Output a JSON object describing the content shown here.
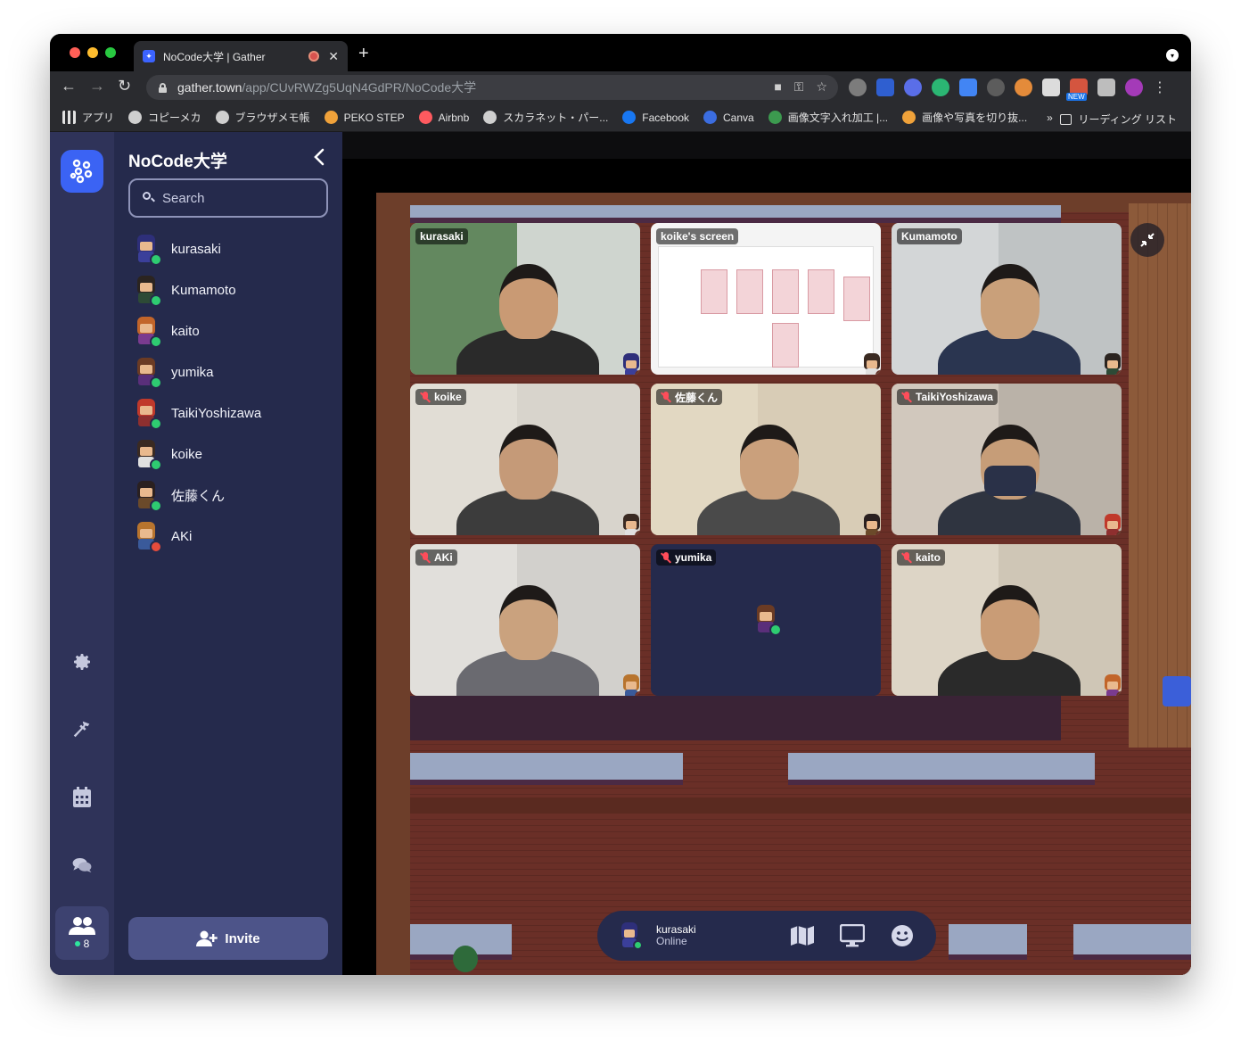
{
  "browser": {
    "tab_title": "NoCode大学 | Gather",
    "tab_close": "✕",
    "new_tab": "+",
    "url_host": "gather.town",
    "url_path": "/app/CUvRWZg5UqN4GdPR/NoCode大学",
    "nav": {
      "back": "←",
      "forward": "→",
      "reload": "↻"
    },
    "ext_new_badge": "NEW",
    "bookmarks": [
      {
        "label": "アプリ",
        "icon": "apps-grid-icon",
        "color": "#e3e3e3"
      },
      {
        "label": "コピーメカ",
        "icon": "globe-icon",
        "color": "#cfcfcf"
      },
      {
        "label": "ブラウザメモ帳",
        "icon": "globe-icon",
        "color": "#cfcfcf"
      },
      {
        "label": "PEKO STEP",
        "icon": "peko-icon",
        "color": "#f0a23a"
      },
      {
        "label": "Airbnb",
        "icon": "airbnb-icon",
        "color": "#ff5a5f"
      },
      {
        "label": "スカラネット・パー...",
        "icon": "globe-icon",
        "color": "#cfcfcf"
      },
      {
        "label": "Facebook",
        "icon": "facebook-icon",
        "color": "#1877f2"
      },
      {
        "label": "Canva",
        "icon": "canva-icon",
        "color": "#3b6de0"
      },
      {
        "label": "画像文字入れ加工 |...",
        "icon": "image-icon",
        "color": "#3c9a4f"
      },
      {
        "label": "画像や写真を切り抜...",
        "icon": "peko-icon",
        "color": "#f0a23a"
      }
    ],
    "bookmarks_more": "»",
    "reading_list": "リーディング リスト"
  },
  "sidebar": {
    "title": "NoCode大学",
    "search_placeholder": "Search",
    "invite_label": "Invite",
    "online_count": "8",
    "users": [
      {
        "name": "kurasaki",
        "hair": "#2e2f7a",
        "shirt": "#3b3f9a",
        "status": "#2ecc71"
      },
      {
        "name": "Kumamoto",
        "hair": "#2b2420",
        "shirt": "#2d4a36",
        "status": "#2ecc71"
      },
      {
        "name": "kaito",
        "hair": "#c2652a",
        "shirt": "#7a3b8f",
        "status": "#2ecc71"
      },
      {
        "name": "yumika",
        "hair": "#6b3b24",
        "shirt": "#5a2f7a",
        "status": "#2ecc71"
      },
      {
        "name": "TaikiYoshizawa",
        "hair": "#c0392b",
        "shirt": "#8e2f2f",
        "status": "#2ecc71"
      },
      {
        "name": "koike",
        "hair": "#3a2a22",
        "shirt": "#e0e0e0",
        "status": "#2ecc71"
      },
      {
        "name": "佐藤くん",
        "hair": "#2a2020",
        "shirt": "#6b4a2a",
        "status": "#2ecc71"
      },
      {
        "name": "AKi",
        "hair": "#b8742e",
        "shirt": "#3a5a9a",
        "status": "#e74c3c"
      }
    ]
  },
  "video_tiles": [
    {
      "label": "kurasaki",
      "muted": false,
      "bg": "#cfd5cf",
      "skin": "#c99a74",
      "shirt": "#2a2a2a",
      "wall": "#3f6e3a",
      "avatar_hair": "#2e2f7a",
      "avatar_shirt": "#3b3f9a"
    },
    {
      "label": "koike's screen",
      "muted": false,
      "bg": "#f4f4f4",
      "screen": true,
      "avatar_hair": "#3a2a22",
      "avatar_shirt": "#e0e0e0"
    },
    {
      "label": "Kumamoto",
      "muted": false,
      "bg": "#bfc3c4",
      "skin": "#c9a07a",
      "shirt": "#2a3550",
      "wall": "#d9dcdd",
      "avatar_hair": "#2b2420",
      "avatar_shirt": "#2d4a36"
    },
    {
      "label": "koike",
      "muted": true,
      "bg": "#d8d4cc",
      "skin": "#c59a78",
      "shirt": "#3c3c3c",
      "wall": "#e4e0d8",
      "avatar_hair": "#3a2a22",
      "avatar_shirt": "#e0e0e0"
    },
    {
      "label": "佐藤くん",
      "muted": true,
      "bg": "#d8ccb6",
      "skin": "#caa07c",
      "shirt": "#4a4a4a",
      "wall": "#e6dcc6",
      "avatar_hair": "#2a2020",
      "avatar_shirt": "#6b4a2a"
    },
    {
      "label": "TaikiYoshizawa",
      "muted": true,
      "bg": "#bab2a8",
      "skin": "#c69d78",
      "shirt": "#2f3440",
      "wall": "#d8cfc4",
      "mask": true,
      "avatar_hair": "#c0392b",
      "avatar_shirt": "#8e2f2f"
    },
    {
      "label": "AKi",
      "muted": true,
      "bg": "#d2d0cc",
      "skin": "#caa27e",
      "shirt": "#6a6a70",
      "wall": "#e6e4e0",
      "avatar_hair": "#b8742e",
      "avatar_shirt": "#3a5a9a",
      "avatar_status": "#e74c3c"
    },
    {
      "label": "yumika",
      "muted": true,
      "bg": "#252a4c",
      "avatar_only": true,
      "avatar_hair": "#6b3b24",
      "avatar_shirt": "#5a2f7a"
    },
    {
      "label": "kaito",
      "muted": true,
      "bg": "#cfc6b6",
      "skin": "#c99c76",
      "shirt": "#2a2a2a",
      "wall": "#e2dacb",
      "avatar_hair": "#c2652a",
      "avatar_shirt": "#7a3b8f"
    }
  ],
  "bottom_bar": {
    "name": "kurasaki",
    "status": "Online"
  }
}
